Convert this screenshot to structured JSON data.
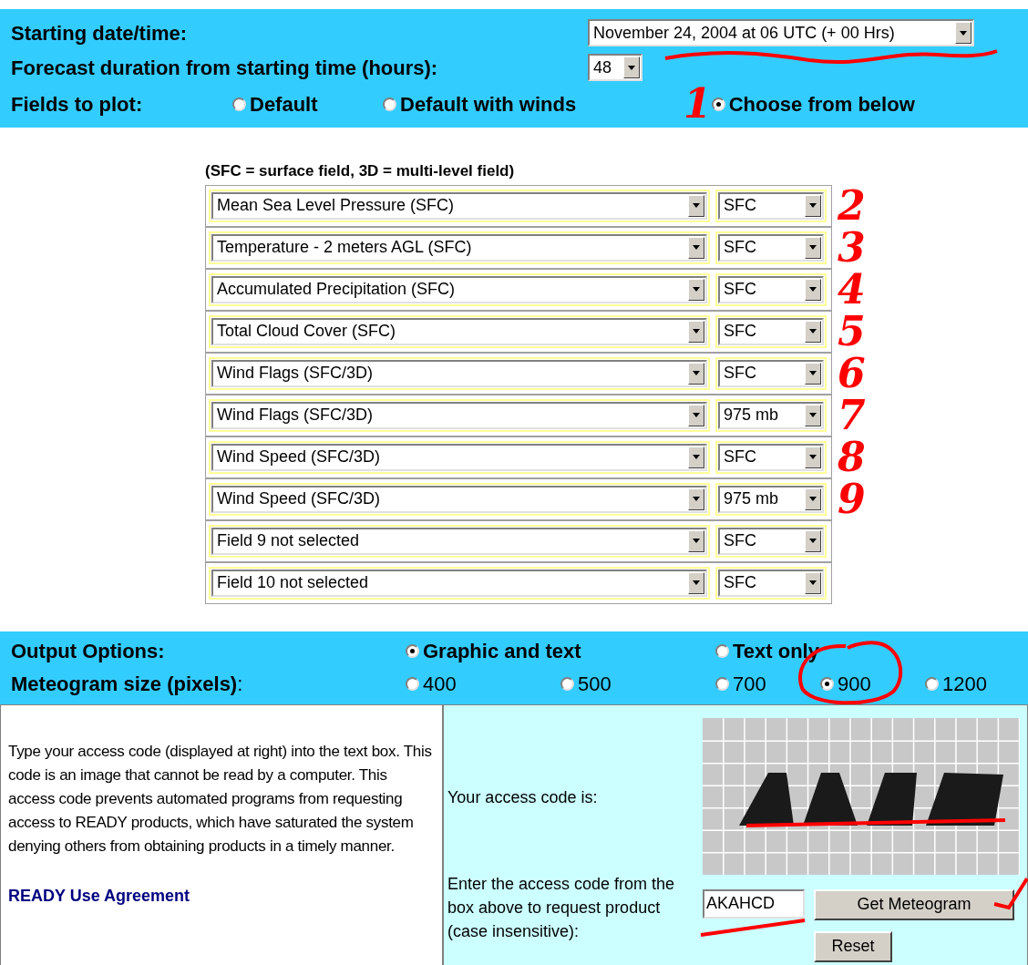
{
  "top": {
    "start_label": "Starting date/time:",
    "start_value": "November 24, 2004 at 06 UTC (+ 00 Hrs)",
    "duration_label": "Forecast duration from starting time (hours):",
    "duration_value": "48",
    "fields_label": "Fields to plot:",
    "field_options": [
      {
        "label": "Default",
        "selected": false
      },
      {
        "label": "Default with winds",
        "selected": false
      },
      {
        "label": "Choose from below",
        "selected": true,
        "annotation": "1"
      }
    ]
  },
  "fields": {
    "note": "(SFC = surface field, 3D = multi-level field)",
    "rows": [
      {
        "field": "Mean Sea Level Pressure (SFC)",
        "level": "SFC",
        "annotation": "2"
      },
      {
        "field": "Temperature - 2 meters AGL (SFC)",
        "level": "SFC",
        "annotation": "3"
      },
      {
        "field": "Accumulated Precipitation (SFC)",
        "level": "SFC",
        "annotation": "4"
      },
      {
        "field": "Total Cloud Cover (SFC)",
        "level": "SFC",
        "annotation": "5"
      },
      {
        "field": "Wind Flags (SFC/3D)",
        "level": "SFC",
        "annotation": "6"
      },
      {
        "field": "Wind Flags (SFC/3D)",
        "level": "975 mb",
        "annotation": "7"
      },
      {
        "field": "Wind Speed (SFC/3D)",
        "level": "SFC",
        "annotation": "8"
      },
      {
        "field": "Wind Speed (SFC/3D)",
        "level": "975 mb",
        "annotation": "9"
      },
      {
        "field": "Field 9 not selected",
        "level": "SFC"
      },
      {
        "field": "Field 10 not selected",
        "level": "SFC"
      }
    ]
  },
  "output": {
    "options_label": "Output Options:",
    "options": [
      {
        "label": "Graphic and text",
        "selected": true
      },
      {
        "label": "Text only",
        "selected": false
      }
    ],
    "size_label": "**Meteogram size (pixels)**:",
    "sizes": [
      {
        "label": "400",
        "selected": false
      },
      {
        "label": "500",
        "selected": false
      },
      {
        "label": "700",
        "selected": false
      },
      {
        "label": "900",
        "selected": true
      },
      {
        "label": "1200",
        "selected": false
      }
    ]
  },
  "access": {
    "description": "Type your access code (displayed at right) into the text box. This code is an image that cannot be read by a computer. This access code prevents automated programs from requesting access to READY products, which have saturated the system denying others from obtaining products in a timely manner.",
    "agreement_link": "READY Use Agreement",
    "code_label": "Your access code is:",
    "enter_label": "Enter the access code from the box above to request product (case insensitive):",
    "code_value": "AKAHCD",
    "submit": "Get Meteogram",
    "reset": "Reset"
  }
}
